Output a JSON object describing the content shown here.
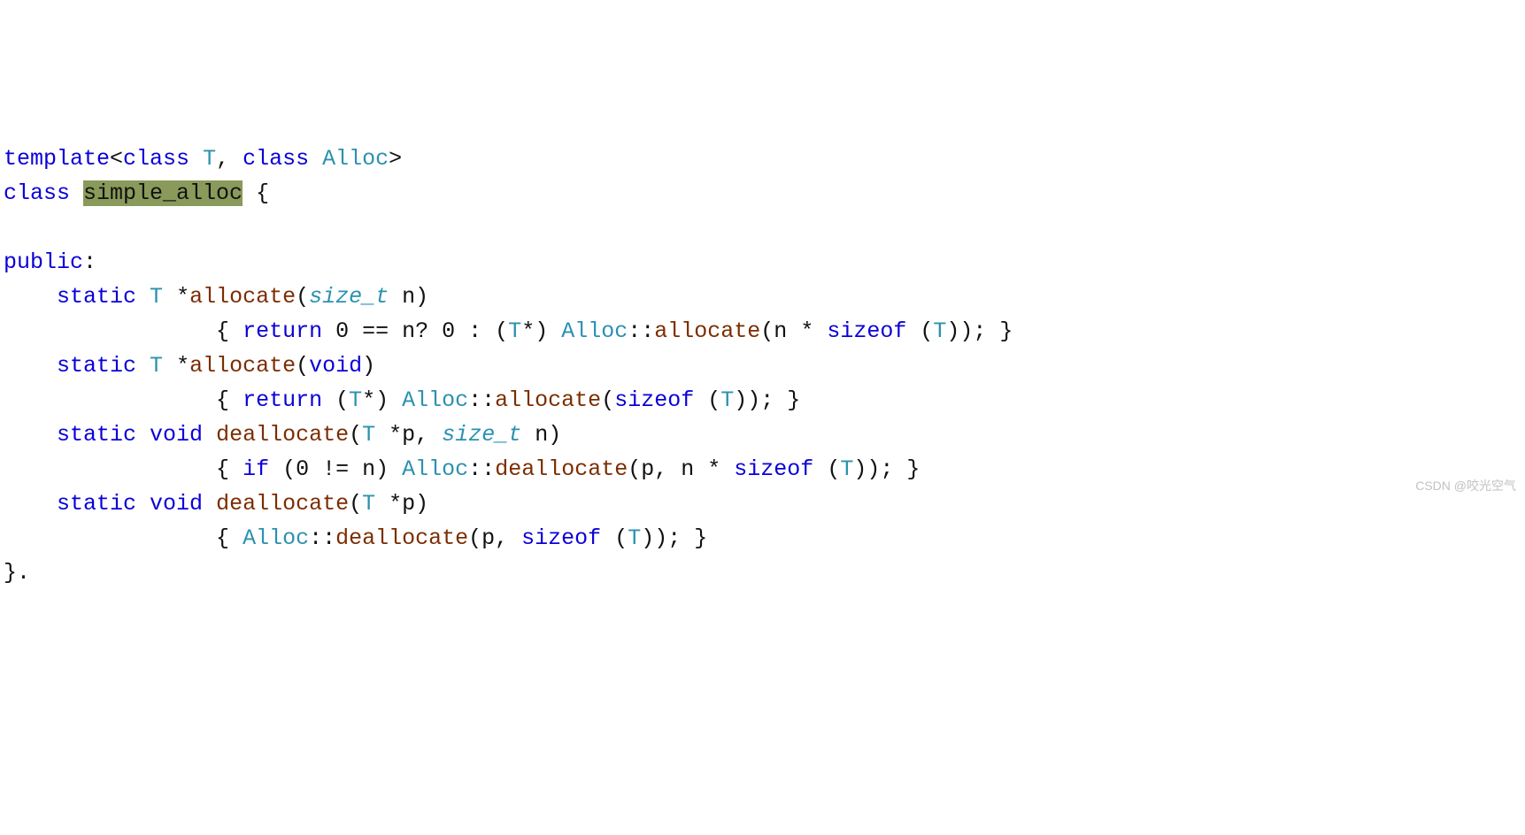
{
  "code": {
    "line1": {
      "kw_template": "template",
      "lt": "<",
      "kw_class1": "class",
      "sp1": " ",
      "T1": "T",
      "comma": ", ",
      "kw_class2": "class",
      "sp2": " ",
      "Alloc": "Alloc",
      "gt": ">"
    },
    "line2": {
      "kw_class": "class",
      "sp": " ",
      "hl_name": "simple_alloc",
      "brace": " {"
    },
    "line3": "",
    "line4": {
      "kw_public": "public",
      "colon": ":"
    },
    "line5": {
      "indent": "    ",
      "kw_static": "static",
      "sp1": " ",
      "T": "T",
      "star": " *",
      "fn": "allocate",
      "open": "(",
      "sizet": "size_t",
      "sp2": " ",
      "n": "n",
      "close": ")"
    },
    "line6": {
      "indent": "                ",
      "open": "{ ",
      "kw_return": "return",
      "sp1": " ",
      "zero": "0",
      "eq": " == ",
      "n": "n",
      "q": "? ",
      "zero2": "0",
      "colon": " : (",
      "T": "T",
      "star": "*) ",
      "Alloc": "Alloc",
      "scope": "::",
      "fn": "allocate",
      "open2": "(",
      "n2": "n",
      "mul": " * ",
      "kw_sizeof": "sizeof",
      "sp2": " (",
      "T2": "T",
      "close2": ")); }"
    },
    "line7": {
      "indent": "    ",
      "kw_static": "static",
      "sp1": " ",
      "T": "T",
      "star": " *",
      "fn": "allocate",
      "open": "(",
      "kw_void": "void",
      "close": ")"
    },
    "line8": {
      "indent": "                ",
      "open": "{ ",
      "kw_return": "return",
      "sp1": " (",
      "T": "T",
      "star": "*) ",
      "Alloc": "Alloc",
      "scope": "::",
      "fn": "allocate",
      "open2": "(",
      "kw_sizeof": "sizeof",
      "sp2": " (",
      "T2": "T",
      "close2": ")); }"
    },
    "line9": {
      "indent": "    ",
      "kw_static": "static",
      "sp1": " ",
      "kw_void": "void",
      "sp2": " ",
      "fn": "deallocate",
      "open": "(",
      "T": "T",
      "star": " *",
      "p": "p",
      "comma": ", ",
      "sizet": "size_t",
      "sp3": " ",
      "n": "n",
      "close": ")"
    },
    "line10": {
      "indent": "                ",
      "open": "{ ",
      "kw_if": "if",
      "sp1": " (",
      "zero": "0",
      "neq": " != ",
      "n": "n",
      "close1": ") ",
      "Alloc": "Alloc",
      "scope": "::",
      "fn": "deallocate",
      "open2": "(",
      "p": "p",
      "comma": ", ",
      "n2": "n",
      "mul": " * ",
      "kw_sizeof": "sizeof",
      "sp2": " (",
      "T": "T",
      "close2": ")); }"
    },
    "line11": {
      "indent": "    ",
      "kw_static": "static",
      "sp1": " ",
      "kw_void": "void",
      "sp2": " ",
      "fn": "deallocate",
      "open": "(",
      "T": "T",
      "star": " *",
      "p": "p",
      "close": ")"
    },
    "line12": {
      "indent": "                ",
      "open": "{ ",
      "Alloc": "Alloc",
      "scope": "::",
      "fn": "deallocate",
      "open2": "(",
      "p": "p",
      "comma": ", ",
      "kw_sizeof": "sizeof",
      "sp2": " (",
      "T": "T",
      "close2": ")); }"
    },
    "line13": "}.",
    "watermark": "CSDN @咬光空气"
  }
}
